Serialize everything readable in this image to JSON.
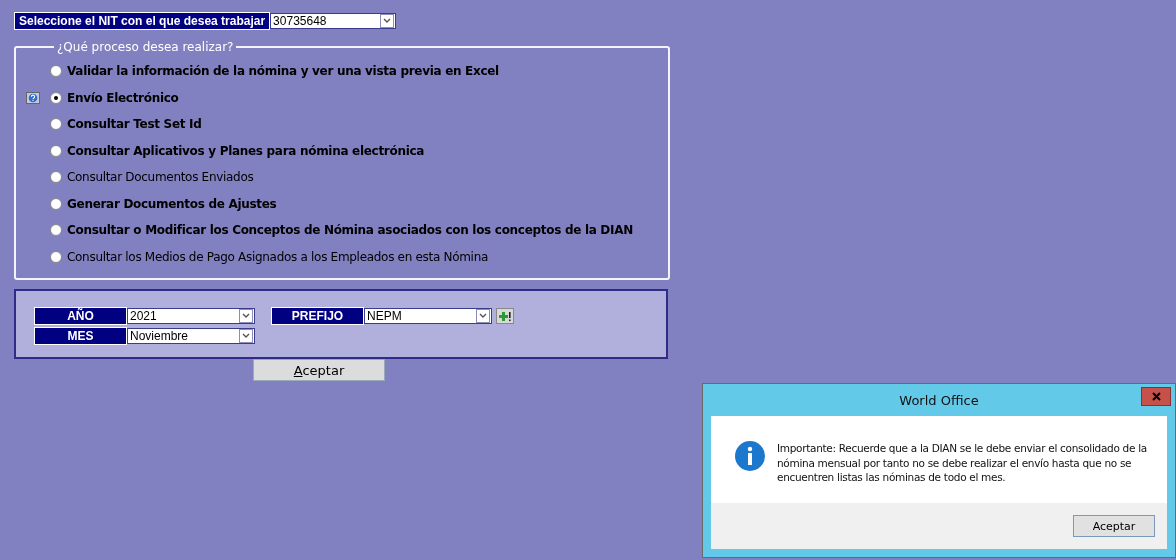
{
  "nit_selector": {
    "label": "Seleccione el NIT con el que desea trabajar",
    "value": "30735648"
  },
  "process_group": {
    "legend": "¿Qué proceso desea realizar?",
    "options": [
      {
        "label": "Validar la información de la nómina y ver una vista previa en Excel",
        "selected": false,
        "bold": true,
        "help_icon": false
      },
      {
        "label": "Envío Electrónico",
        "selected": true,
        "bold": true,
        "help_icon": true
      },
      {
        "label": "Consultar Test Set Id",
        "selected": false,
        "bold": true,
        "help_icon": false
      },
      {
        "label": "Consultar Aplicativos y Planes para nómina electrónica",
        "selected": false,
        "bold": true,
        "help_icon": false
      },
      {
        "label": "Consultar Documentos Enviados",
        "selected": false,
        "bold": false,
        "help_icon": false
      },
      {
        "label": "Generar Documentos de Ajustes",
        "selected": false,
        "bold": true,
        "help_icon": false
      },
      {
        "label": "Consultar o Modificar los Conceptos de Nómina asociados con los conceptos de la DIAN",
        "selected": false,
        "bold": true,
        "help_icon": false
      },
      {
        "label": "Consultar los Medios de Pago Asignados a los Empleados en esta Nómina",
        "selected": false,
        "bold": false,
        "help_icon": false
      }
    ]
  },
  "period_panel": {
    "year": {
      "label": "AÑO",
      "value": "2021"
    },
    "month": {
      "label": "MES",
      "value": "Noviembre"
    },
    "prefix": {
      "label": "PREFIJO",
      "value": "NEPM"
    }
  },
  "accept_button": "Aceptar",
  "dialog": {
    "title": "World Office",
    "message": "Importante: Recuerde que a la DIAN se le debe enviar el consolidado de la nómina mensual por tanto no se debe realizar el envío hasta que no se encuentren listas las nóminas de todo el mes.",
    "button": "Aceptar"
  }
}
